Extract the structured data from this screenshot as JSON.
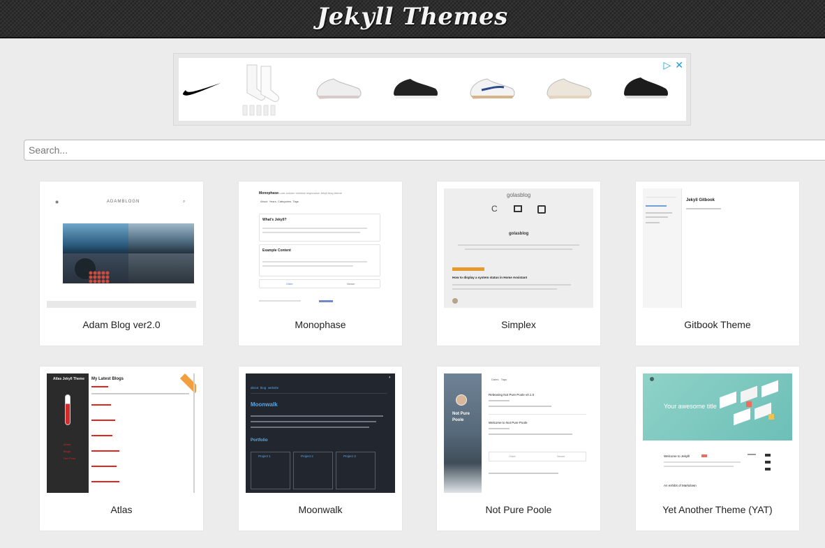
{
  "header": {
    "title": "Jekyll Themes"
  },
  "ad": {
    "info_icon": "ad-choices-icon",
    "close_icon": "close-icon"
  },
  "search": {
    "placeholder": "Search...",
    "value": ""
  },
  "themes": [
    {
      "title": "Adam Blog ver2.0"
    },
    {
      "title": "Monophase"
    },
    {
      "title": "Simplex"
    },
    {
      "title": "Gitbook Theme"
    },
    {
      "title": "Atlas"
    },
    {
      "title": "Moonwalk"
    },
    {
      "title": "Not Pure Poole"
    },
    {
      "title": "Yet Another Theme (YAT)"
    }
  ],
  "previews": {
    "adam": {
      "brand": "ADAMBLOGN"
    },
    "monophase": {
      "name": "Monophase",
      "tagline": "A one-column minimal responsive Jekyll blog theme",
      "nav": [
        "About",
        "Years",
        "Categories",
        "Tags"
      ],
      "post1_title": "What's Jekyll?",
      "post2_title": "Example Content",
      "older": "Older",
      "newer": "Newer"
    },
    "simplex": {
      "logo": "golasblog",
      "heading": "golasblog",
      "post_title": "How to display a system status in Home Assistant"
    },
    "gitbook": {
      "heading": "Jekyll Gitbook"
    },
    "atlas": {
      "sidebar_title": "Atlas Jekyll Theme",
      "heading": "My Latest Blogs",
      "links": [
        "About",
        "Blogs",
        "Dev Feed"
      ]
    },
    "moonwalk": {
      "nav": [
        "about",
        "blog",
        "website"
      ],
      "heading": "Moonwalk",
      "section": "Portfolio",
      "projects": [
        "Project 1",
        "Project 2",
        "Project 3"
      ]
    },
    "notpurepoole": {
      "name": "Not Pure Poole",
      "tabs": [
        "Dates",
        "Tags"
      ],
      "post1": "Releasing Not Pure Poole v0.1.0",
      "post2": "Welcome to Not Pure Poole",
      "older": "Older",
      "newer": "Newer"
    },
    "yat": {
      "hero": "Your awesome title",
      "post1": "Welcome to Jekyll!",
      "post2": "An exhibit of Markdown"
    }
  },
  "colors": {
    "header_bg": "#2e2e2e",
    "page_bg": "#ececec",
    "atlas_red": "#e0261f",
    "moonwalk_blue": "#5aa8e6",
    "yat_teal": "#7cc8c0"
  }
}
